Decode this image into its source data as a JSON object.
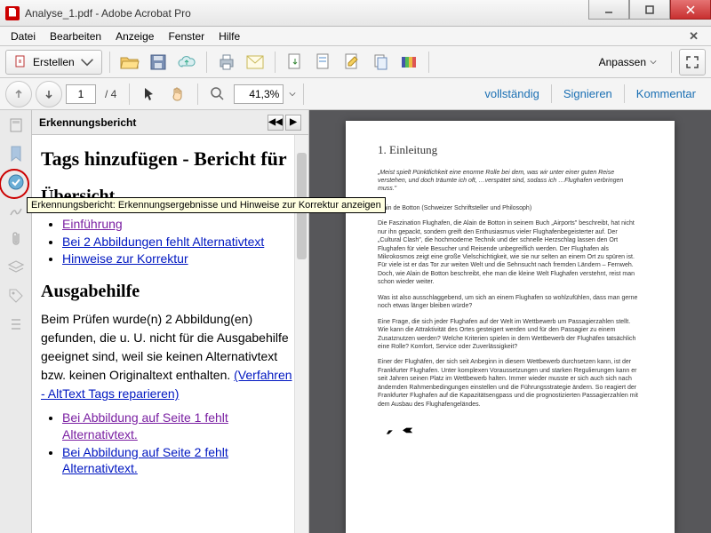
{
  "window": {
    "title": "Analyse_1.pdf - Adobe Acrobat Pro"
  },
  "menu": {
    "items": [
      "Datei",
      "Bearbeiten",
      "Anzeige",
      "Fenster",
      "Hilfe"
    ]
  },
  "toolbar1": {
    "create_label": "Erstellen",
    "anpassen": "Anpassen"
  },
  "toolbar2": {
    "page_current": "1",
    "page_total": "/ 4",
    "zoom": "41,3%",
    "actions": {
      "voll": "vollständig",
      "sign": "Signieren",
      "komm": "Kommentar"
    }
  },
  "sidepanel": {
    "title": "Erkennungsbericht",
    "h1": "Tags hinzufügen - Bericht für",
    "h2a": "Übersicht",
    "links_a": [
      {
        "text": "Einführung",
        "cls": "purple"
      },
      {
        "text": "Bei 2 Abbildungen fehlt Alternativtext",
        "cls": "blue"
      },
      {
        "text": "Hinweise zur Korrektur",
        "cls": "blue"
      }
    ],
    "h2b": "Ausgabehilfe",
    "para": "Beim Prüfen wurde(n) 2 Abbildung(en) gefunden, die u. U. nicht für die Ausgabehilfe geeignet sind, weil sie keinen Alternativtext bzw. keinen Originaltext enthalten. ",
    "para_link": "(Verfahren - AltText Tags reparieren)",
    "links_b": [
      {
        "text": "Bei Abbildung auf Seite 1 fehlt Alternativtext.",
        "cls": "purple"
      },
      {
        "text": "Bei Abbildung auf Seite 2 fehlt Alternativtext.",
        "cls": "blue"
      }
    ]
  },
  "tooltip": "Erkennungsbericht: Erkennungsergebnisse und Hinweise zur Korrektur anzeigen",
  "pdf": {
    "title": "1. Einleitung",
    "quote": "„Meist spielt Pünktlichkeit eine enorme Rolle bei dem, was wir unter einer guten Reise verstehen, und doch träumte ich oft, …verspätet sind, sodass ich …Flughafen verbringen muss.\"",
    "author": "Alain de Botton (Schweizer Schriftsteller und Philosoph)",
    "p1": "Die Faszination Flughafen, die Alain de Botton in seinem Buch „Airports\" beschreibt, hat nicht nur ihn gepackt, sondern greift den Enthusiasmus vieler Flughafenbegeisterter auf. Der „Cultural Clash\", die hochmoderne Technik und der schnelle Herzschlag lassen den Ort Flughafen für viele Besucher und Reisende unbegreiflich werden. Der Flughafen als Mikrokosmos zeigt eine große Vielschichtigkeit, wie sie nur selten an einem Ort zu spüren ist. Für viele ist er das Tor zur weiten Welt und die Sehnsucht nach fremden Ländern – Fernweh. Doch, wie Alain de Botton beschreibt, ehe man die kleine Welt Flughafen verstehnt, reist man schon wieder weiter.",
    "p2": "Was ist also ausschlaggebend, um sich an einem Flughafen so wohlzufühlen, dass man gerne noch etwas länger bleiben würde?",
    "p3": "Eine Frage, die sich jeder Flughafen auf der Welt im Wettbewerb um Passagierzahlen stellt. Wie kann die Attraktivität des Ortes gesteigert werden und für den Passagier zu einem Zusatznutzen werden? Welche Kriterien spielen in dem Wettbewerb der Flughäfen tatsächlich eine Rolle? Komfort, Service oder Zuverlässigkeit?",
    "p4": "Einer der Flughäfen, der sich seit Anbeginn in diesem Wettbewerb durchsetzen kann, ist der Frankfurter Flughafen. Unter komplexen Voraussetzungen und starken Regulierungen kann er seit Jahren seinen Platz im Wettbewerb halten. Immer wieder musste er sich auch sich nach ändernden Rahmenbedingungen einstellen und die Führungsstrategie ändern. So reagiert der Frankfurter Flughafen auf die Kapazitätsengpass und die prognostizierten Passagierzahlen mit dem Ausbau des Flughafengeländes."
  }
}
